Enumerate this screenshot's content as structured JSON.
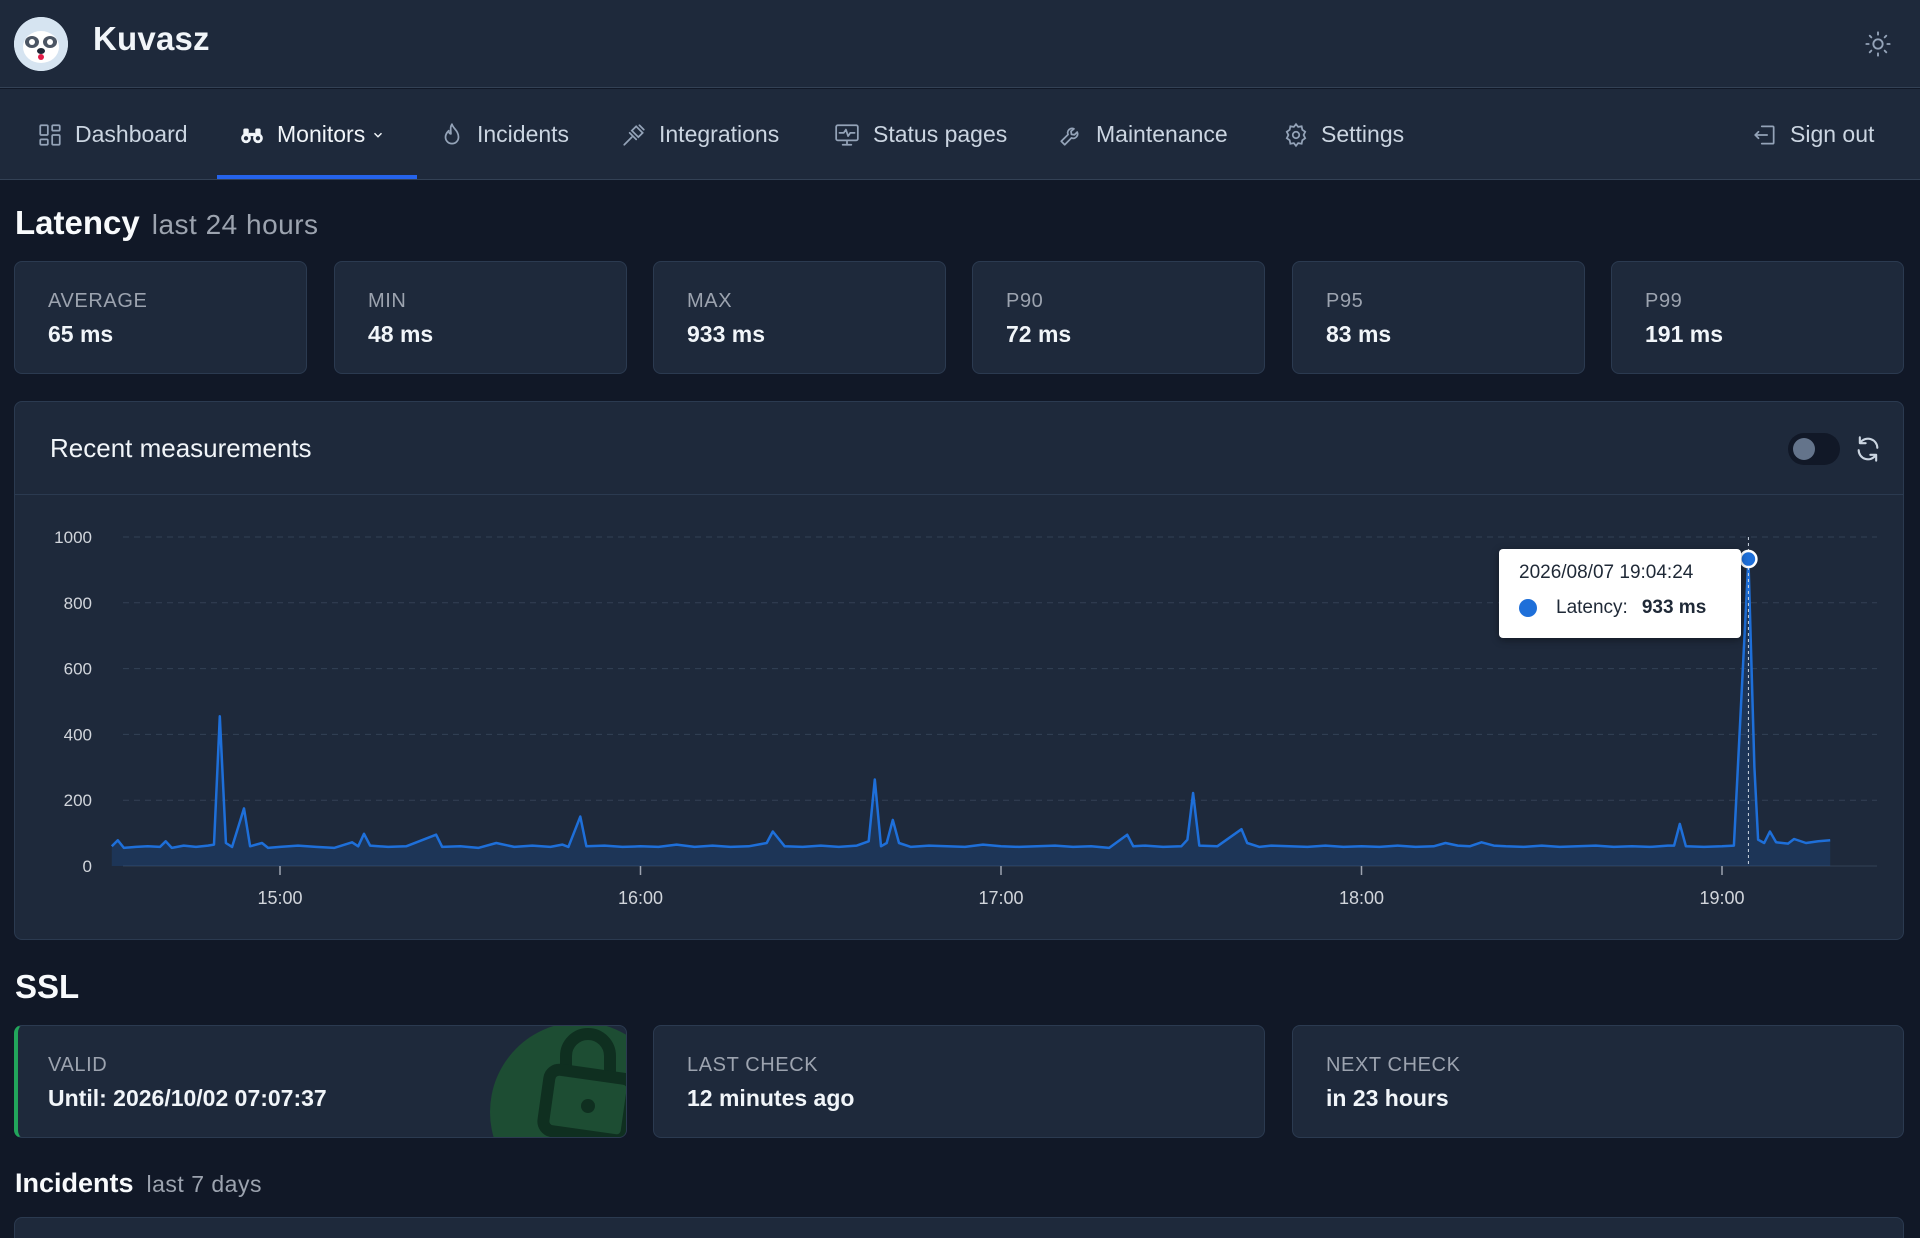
{
  "header": {
    "title": "Kuvasz"
  },
  "nav": {
    "items": [
      {
        "label": "Dashboard"
      },
      {
        "label": "Monitors"
      },
      {
        "label": "Incidents"
      },
      {
        "label": "Integrations"
      },
      {
        "label": "Status pages"
      },
      {
        "label": "Maintenance"
      },
      {
        "label": "Settings"
      }
    ],
    "sign_out": "Sign out",
    "active": "Monitors"
  },
  "latency": {
    "title": "Latency",
    "subtitle": "last 24 hours",
    "stats": [
      {
        "label": "AVERAGE",
        "value": "65 ms"
      },
      {
        "label": "MIN",
        "value": "48 ms"
      },
      {
        "label": "MAX",
        "value": "933 ms"
      },
      {
        "label": "P90",
        "value": "72 ms"
      },
      {
        "label": "P95",
        "value": "83 ms"
      },
      {
        "label": "P99",
        "value": "191 ms"
      }
    ]
  },
  "measurements": {
    "title": "Recent measurements",
    "auto_refresh_on": false,
    "tooltip": {
      "date": "2026/08/07 19:04:24",
      "label": "Latency:",
      "value": "933 ms"
    }
  },
  "chart_data": {
    "type": "area",
    "xlabel": "",
    "ylabel": "",
    "ylim": [
      0,
      1000
    ],
    "yticks": [
      0,
      200,
      400,
      600,
      800,
      1000
    ],
    "xtick_labels": [
      "15:00",
      "16:00",
      "17:00",
      "18:00",
      "19:00"
    ],
    "xlim_minutes": [
      14.5333,
      19.3
    ],
    "x_unit": "hour of day",
    "grid": true,
    "color": "#1e6fd9",
    "series": [
      {
        "points": [
          [
            14.5333,
            60
          ],
          [
            14.55,
            78
          ],
          [
            14.567,
            55
          ],
          [
            14.6,
            58
          ],
          [
            14.633,
            60
          ],
          [
            14.667,
            58
          ],
          [
            14.683,
            75
          ],
          [
            14.7,
            55
          ],
          [
            14.733,
            62
          ],
          [
            14.767,
            58
          ],
          [
            14.8,
            62
          ],
          [
            14.817,
            65
          ],
          [
            14.833,
            455
          ],
          [
            14.85,
            70
          ],
          [
            14.867,
            58
          ],
          [
            14.9,
            175
          ],
          [
            14.917,
            60
          ],
          [
            14.95,
            70
          ],
          [
            14.967,
            55
          ],
          [
            15.0,
            58
          ],
          [
            15.05,
            62
          ],
          [
            15.1,
            58
          ],
          [
            15.15,
            55
          ],
          [
            15.2,
            72
          ],
          [
            15.217,
            60
          ],
          [
            15.233,
            98
          ],
          [
            15.25,
            62
          ],
          [
            15.3,
            58
          ],
          [
            15.35,
            60
          ],
          [
            15.433,
            95
          ],
          [
            15.45,
            58
          ],
          [
            15.5,
            60
          ],
          [
            15.55,
            55
          ],
          [
            15.6,
            70
          ],
          [
            15.65,
            58
          ],
          [
            15.7,
            62
          ],
          [
            15.75,
            58
          ],
          [
            15.783,
            65
          ],
          [
            15.8,
            58
          ],
          [
            15.833,
            150
          ],
          [
            15.85,
            60
          ],
          [
            15.9,
            62
          ],
          [
            15.95,
            58
          ],
          [
            16.0,
            60
          ],
          [
            16.05,
            58
          ],
          [
            16.1,
            65
          ],
          [
            16.15,
            58
          ],
          [
            16.2,
            62
          ],
          [
            16.25,
            58
          ],
          [
            16.3,
            60
          ],
          [
            16.35,
            70
          ],
          [
            16.367,
            105
          ],
          [
            16.4,
            60
          ],
          [
            16.45,
            58
          ],
          [
            16.5,
            62
          ],
          [
            16.55,
            58
          ],
          [
            16.6,
            62
          ],
          [
            16.633,
            75
          ],
          [
            16.65,
            263
          ],
          [
            16.667,
            60
          ],
          [
            16.683,
            70
          ],
          [
            16.7,
            140
          ],
          [
            16.717,
            70
          ],
          [
            16.75,
            58
          ],
          [
            16.8,
            62
          ],
          [
            16.85,
            60
          ],
          [
            16.9,
            58
          ],
          [
            16.95,
            65
          ],
          [
            17.0,
            60
          ],
          [
            17.05,
            58
          ],
          [
            17.1,
            60
          ],
          [
            17.15,
            62
          ],
          [
            17.2,
            58
          ],
          [
            17.25,
            60
          ],
          [
            17.3,
            55
          ],
          [
            17.35,
            95
          ],
          [
            17.367,
            60
          ],
          [
            17.4,
            62
          ],
          [
            17.45,
            58
          ],
          [
            17.5,
            60
          ],
          [
            17.517,
            80
          ],
          [
            17.533,
            222
          ],
          [
            17.55,
            62
          ],
          [
            17.6,
            60
          ],
          [
            17.667,
            112
          ],
          [
            17.683,
            70
          ],
          [
            17.717,
            58
          ],
          [
            17.75,
            62
          ],
          [
            17.8,
            60
          ],
          [
            17.85,
            58
          ],
          [
            17.9,
            62
          ],
          [
            17.95,
            58
          ],
          [
            18.0,
            60
          ],
          [
            18.05,
            58
          ],
          [
            18.1,
            62
          ],
          [
            18.15,
            58
          ],
          [
            18.2,
            60
          ],
          [
            18.233,
            70
          ],
          [
            18.267,
            62
          ],
          [
            18.3,
            60
          ],
          [
            18.333,
            72
          ],
          [
            18.367,
            62
          ],
          [
            18.4,
            60
          ],
          [
            18.45,
            58
          ],
          [
            18.5,
            62
          ],
          [
            18.55,
            58
          ],
          [
            18.6,
            60
          ],
          [
            18.65,
            62
          ],
          [
            18.7,
            58
          ],
          [
            18.75,
            60
          ],
          [
            18.8,
            58
          ],
          [
            18.85,
            62
          ],
          [
            18.867,
            62
          ],
          [
            18.883,
            128
          ],
          [
            18.9,
            60
          ],
          [
            18.95,
            58
          ],
          [
            19.0,
            60
          ],
          [
            19.033,
            62
          ],
          [
            19.0733,
            933
          ],
          [
            19.09,
            300
          ],
          [
            19.1,
            80
          ],
          [
            19.117,
            70
          ],
          [
            19.133,
            105
          ],
          [
            19.15,
            72
          ],
          [
            19.183,
            68
          ],
          [
            19.2,
            82
          ],
          [
            19.233,
            70
          ],
          [
            19.267,
            75
          ],
          [
            19.3,
            78
          ]
        ]
      }
    ]
  },
  "ssl": {
    "title": "SSL",
    "valid_label": "VALID",
    "valid_value": "Until: 2026/10/02 07:07:37",
    "last_check_label": "LAST CHECK",
    "last_check_value": "12 minutes ago",
    "next_check_label": "NEXT CHECK",
    "next_check_value": "in 23 hours",
    "status_color": "#22a55b"
  },
  "incidents": {
    "title": "Incidents",
    "subtitle": "last 7 days"
  }
}
